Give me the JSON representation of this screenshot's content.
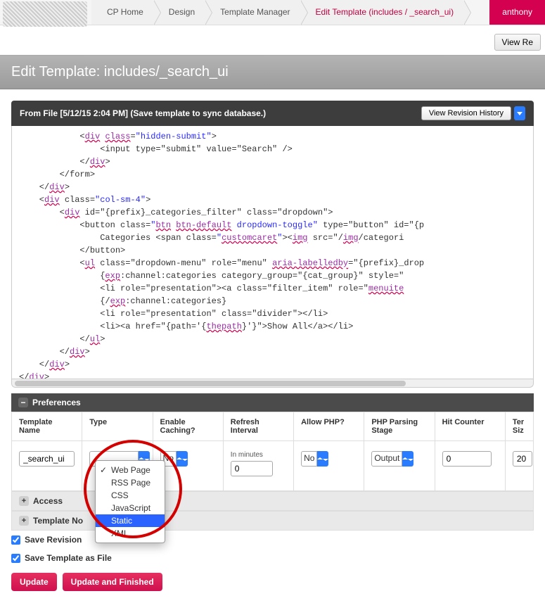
{
  "breadcrumb": {
    "items": [
      "CP Home",
      "Design",
      "Template Manager",
      "Edit Template (includes / _search_ui)"
    ]
  },
  "user": "anthony",
  "view_re_button": "View Re",
  "page_title": "Edit Template: includes/_search_ui",
  "sub_header": "From File [5/12/15 2:04 PM] (Save template to sync database.)",
  "revision_button": "View Revision History",
  "preferences_label": "Preferences",
  "columns": {
    "template_name": "Template Name",
    "type": "Type",
    "enable_caching": "Enable Caching?",
    "refresh_interval": "Refresh Interval",
    "allow_php": "Allow PHP?",
    "php_stage": "PHP Parsing Stage",
    "hit_counter": "Hit Counter",
    "ter_size": "Ter Siz"
  },
  "values": {
    "template_name": "_search_ui",
    "type": "Web Page",
    "enable_caching": "No",
    "refresh_note": "In minutes",
    "refresh_interval": "0",
    "allow_php": "No",
    "php_stage": "Output",
    "hit_counter": "0",
    "ter_size": "20"
  },
  "type_options": [
    "Web Page",
    "RSS Page",
    "CSS",
    "JavaScript",
    "Static",
    "XML"
  ],
  "type_checked": "Web Page",
  "type_highlighted": "Static",
  "collapsed_sections": [
    "Access",
    "Template No"
  ],
  "checkboxes": {
    "save_revision": "Save Revision",
    "save_as_file": "Save Template as File"
  },
  "buttons": {
    "update": "Update",
    "update_finished": "Update and Finished"
  }
}
